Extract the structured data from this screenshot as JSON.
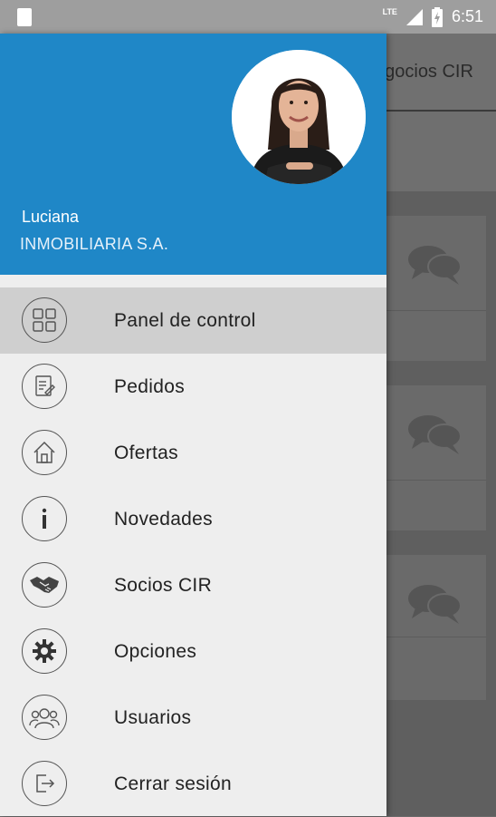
{
  "status_bar": {
    "network": "LTE",
    "time": "6:51"
  },
  "background": {
    "title": "Negocios CIR",
    "title_visible": "egocios CIR"
  },
  "drawer": {
    "header_color": "#1f87c7",
    "user": {
      "name": "Luciana",
      "company": "INMOBILIARIA S.A."
    },
    "items": [
      {
        "label": "Panel de control",
        "icon": "dashboard-grid-icon",
        "active": true
      },
      {
        "label": "Pedidos",
        "icon": "document-icon",
        "active": false
      },
      {
        "label": "Ofertas",
        "icon": "house-icon",
        "active": false
      },
      {
        "label": "Novedades",
        "icon": "info-icon",
        "active": false
      },
      {
        "label": "Socios CIR",
        "icon": "handshake-icon",
        "active": false
      },
      {
        "label": "Opciones",
        "icon": "gear-icon",
        "active": false
      },
      {
        "label": "Usuarios",
        "icon": "users-icon",
        "active": false
      },
      {
        "label": "Cerrar sesión",
        "icon": "logout-icon",
        "active": false
      }
    ]
  }
}
